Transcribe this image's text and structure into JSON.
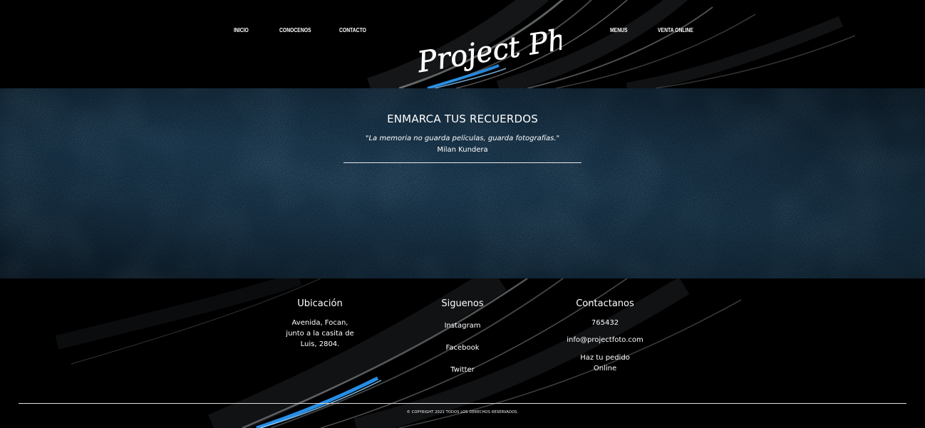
{
  "header": {
    "nav_left": [
      "INICIO",
      "CONOCENOS",
      "CONTACTO"
    ],
    "nav_right": [
      "MENUS",
      "VENTA ONLINE"
    ],
    "logo_text": "Project Photo"
  },
  "hero": {
    "title": "ENMARCA TUS RECUERDOS",
    "quote": "\"La memoria no guarda películas, guarda fotografías.\"",
    "author": "Milan Kundera"
  },
  "footer": {
    "location": {
      "title": "Ubicación",
      "lines": [
        "Avenida, Focan,",
        "junto a la casita de",
        "Luis, 2804."
      ]
    },
    "follow": {
      "title": "Siguenos",
      "links": [
        "Instagram",
        "Facebook",
        "Twitter"
      ]
    },
    "contact": {
      "title": "Contactanos",
      "phone": "765432",
      "email": "info@projectfoto.com",
      "order_lines": [
        "Haz tu pedido",
        "Online"
      ]
    },
    "copyright": "© COPYRIGHT 2021 TODOS LOS DERECHOS RESERVADOS."
  },
  "colors": {
    "background": "#000000",
    "hero_blue": "#1d3a52",
    "accent_blue": "#2a9dff",
    "text": "#ffffff"
  }
}
